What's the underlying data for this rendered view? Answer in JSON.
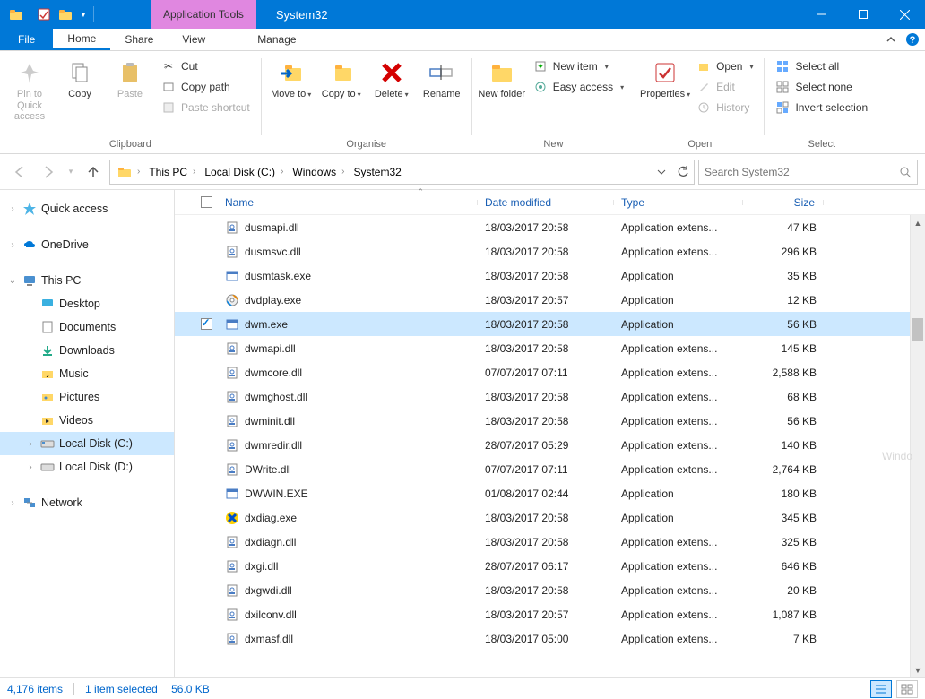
{
  "titlebar": {
    "app_tools_label": "Application Tools",
    "title": "System32"
  },
  "tabs": {
    "file": "File",
    "home": "Home",
    "share": "Share",
    "view": "View",
    "manage": "Manage"
  },
  "ribbon": {
    "clipboard": {
      "label": "Clipboard",
      "pin": "Pin to Quick access",
      "copy": "Copy",
      "paste": "Paste",
      "cut": "Cut",
      "copy_path": "Copy path",
      "paste_shortcut": "Paste shortcut"
    },
    "organise": {
      "label": "Organise",
      "move_to": "Move to",
      "copy_to": "Copy to",
      "delete": "Delete",
      "rename": "Rename"
    },
    "new": {
      "label": "New",
      "new_folder": "New folder",
      "new_item": "New item",
      "easy_access": "Easy access"
    },
    "open": {
      "label": "Open",
      "properties": "Properties",
      "open": "Open",
      "edit": "Edit",
      "history": "History"
    },
    "select": {
      "label": "Select",
      "select_all": "Select all",
      "select_none": "Select none",
      "invert": "Invert selection"
    }
  },
  "breadcrumbs": [
    "This PC",
    "Local Disk (C:)",
    "Windows",
    "System32"
  ],
  "search": {
    "placeholder": "Search System32"
  },
  "navpane": {
    "quick_access": "Quick access",
    "onedrive": "OneDrive",
    "this_pc": "This PC",
    "desktop": "Desktop",
    "documents": "Documents",
    "downloads": "Downloads",
    "music": "Music",
    "pictures": "Pictures",
    "videos": "Videos",
    "local_c": "Local Disk (C:)",
    "local_d": "Local Disk (D:)",
    "network": "Network"
  },
  "columns": {
    "name": "Name",
    "date": "Date modified",
    "type": "Type",
    "size": "Size"
  },
  "files": [
    {
      "icon": "dll",
      "name": "dusmapi.dll",
      "date": "18/03/2017 20:58",
      "type": "Application extens...",
      "size": "47 KB",
      "selected": false
    },
    {
      "icon": "dll",
      "name": "dusmsvc.dll",
      "date": "18/03/2017 20:58",
      "type": "Application extens...",
      "size": "296 KB",
      "selected": false
    },
    {
      "icon": "exe",
      "name": "dusmtask.exe",
      "date": "18/03/2017 20:58",
      "type": "Application",
      "size": "35 KB",
      "selected": false
    },
    {
      "icon": "dvd",
      "name": "dvdplay.exe",
      "date": "18/03/2017 20:57",
      "type": "Application",
      "size": "12 KB",
      "selected": false
    },
    {
      "icon": "exe",
      "name": "dwm.exe",
      "date": "18/03/2017 20:58",
      "type": "Application",
      "size": "56 KB",
      "selected": true
    },
    {
      "icon": "dll",
      "name": "dwmapi.dll",
      "date": "18/03/2017 20:58",
      "type": "Application extens...",
      "size": "145 KB",
      "selected": false
    },
    {
      "icon": "dll",
      "name": "dwmcore.dll",
      "date": "07/07/2017 07:11",
      "type": "Application extens...",
      "size": "2,588 KB",
      "selected": false
    },
    {
      "icon": "dll",
      "name": "dwmghost.dll",
      "date": "18/03/2017 20:58",
      "type": "Application extens...",
      "size": "68 KB",
      "selected": false
    },
    {
      "icon": "dll",
      "name": "dwminit.dll",
      "date": "18/03/2017 20:58",
      "type": "Application extens...",
      "size": "56 KB",
      "selected": false
    },
    {
      "icon": "dll",
      "name": "dwmredir.dll",
      "date": "28/07/2017 05:29",
      "type": "Application extens...",
      "size": "140 KB",
      "selected": false
    },
    {
      "icon": "dll",
      "name": "DWrite.dll",
      "date": "07/07/2017 07:11",
      "type": "Application extens...",
      "size": "2,764 KB",
      "selected": false
    },
    {
      "icon": "exe",
      "name": "DWWIN.EXE",
      "date": "01/08/2017 02:44",
      "type": "Application",
      "size": "180 KB",
      "selected": false
    },
    {
      "icon": "dx",
      "name": "dxdiag.exe",
      "date": "18/03/2017 20:58",
      "type": "Application",
      "size": "345 KB",
      "selected": false
    },
    {
      "icon": "dll",
      "name": "dxdiagn.dll",
      "date": "18/03/2017 20:58",
      "type": "Application extens...",
      "size": "325 KB",
      "selected": false
    },
    {
      "icon": "dll",
      "name": "dxgi.dll",
      "date": "28/07/2017 06:17",
      "type": "Application extens...",
      "size": "646 KB",
      "selected": false
    },
    {
      "icon": "dll",
      "name": "dxgwdi.dll",
      "date": "18/03/2017 20:58",
      "type": "Application extens...",
      "size": "20 KB",
      "selected": false
    },
    {
      "icon": "dll",
      "name": "dxilconv.dll",
      "date": "18/03/2017 20:57",
      "type": "Application extens...",
      "size": "1,087 KB",
      "selected": false
    },
    {
      "icon": "dll",
      "name": "dxmasf.dll",
      "date": "18/03/2017 05:00",
      "type": "Application extens...",
      "size": "7 KB",
      "selected": false
    }
  ],
  "status": {
    "items": "4,176 items",
    "selected": "1 item selected",
    "size": "56.0 KB"
  },
  "ghost_text": "Windo"
}
